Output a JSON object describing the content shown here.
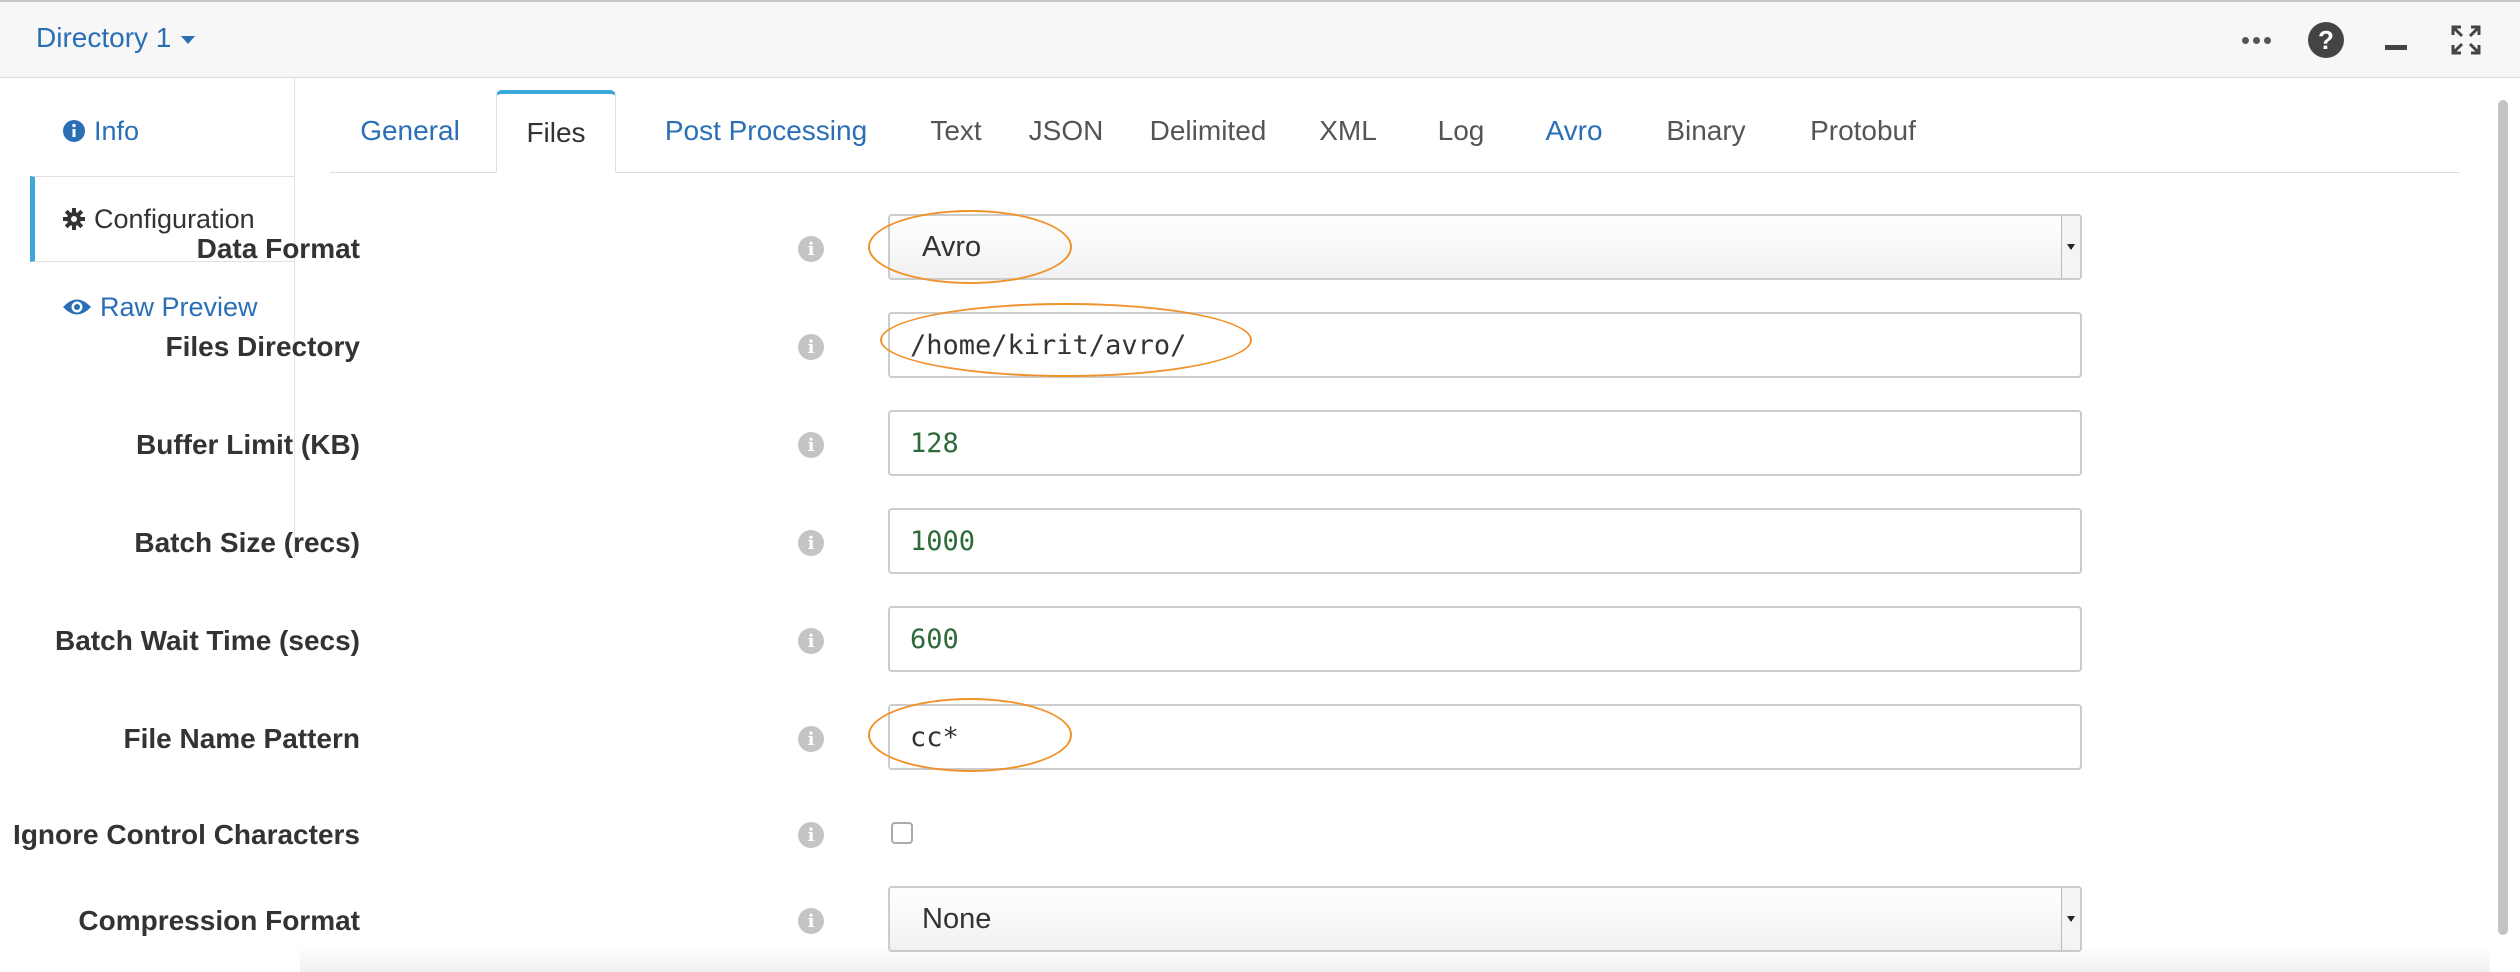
{
  "header": {
    "title": "Directory 1",
    "controls": [
      "more-icon",
      "help-icon",
      "minimize-icon",
      "expand-icon"
    ]
  },
  "sidebar": {
    "items": [
      {
        "label": "Info",
        "icon": "info-icon"
      },
      {
        "label": "Configuration",
        "icon": "gear-icon",
        "active": true
      },
      {
        "label": "Raw Preview",
        "icon": "eye-icon"
      }
    ]
  },
  "tabs": [
    {
      "label": "General"
    },
    {
      "label": "Files",
      "active": true
    },
    {
      "label": "Post Processing"
    },
    {
      "label": "Text"
    },
    {
      "label": "JSON"
    },
    {
      "label": "Delimited"
    },
    {
      "label": "XML"
    },
    {
      "label": "Log"
    },
    {
      "label": "Avro"
    },
    {
      "label": "Binary"
    },
    {
      "label": "Protobuf"
    }
  ],
  "form": {
    "data_format": {
      "label": "Data Format",
      "value": "Avro"
    },
    "files_directory": {
      "label": "Files Directory",
      "value": "/home/kirit/avro/"
    },
    "buffer_limit": {
      "label": "Buffer Limit (KB)",
      "value": "128"
    },
    "batch_size": {
      "label": "Batch Size (recs)",
      "value": "1000"
    },
    "batch_wait": {
      "label": "Batch Wait Time (secs)",
      "value": "600"
    },
    "file_name_pattern": {
      "label": "File Name Pattern",
      "value": "cc*"
    },
    "ignore_control": {
      "label": "Ignore Control Characters",
      "checked": false
    },
    "compression": {
      "label": "Compression Format",
      "value": "None"
    }
  },
  "colors": {
    "link": "#2a6fb5",
    "accent": "#3aa8d8",
    "highlight_oval": "#f0922b",
    "numeric_value": "#2d6b3a"
  }
}
